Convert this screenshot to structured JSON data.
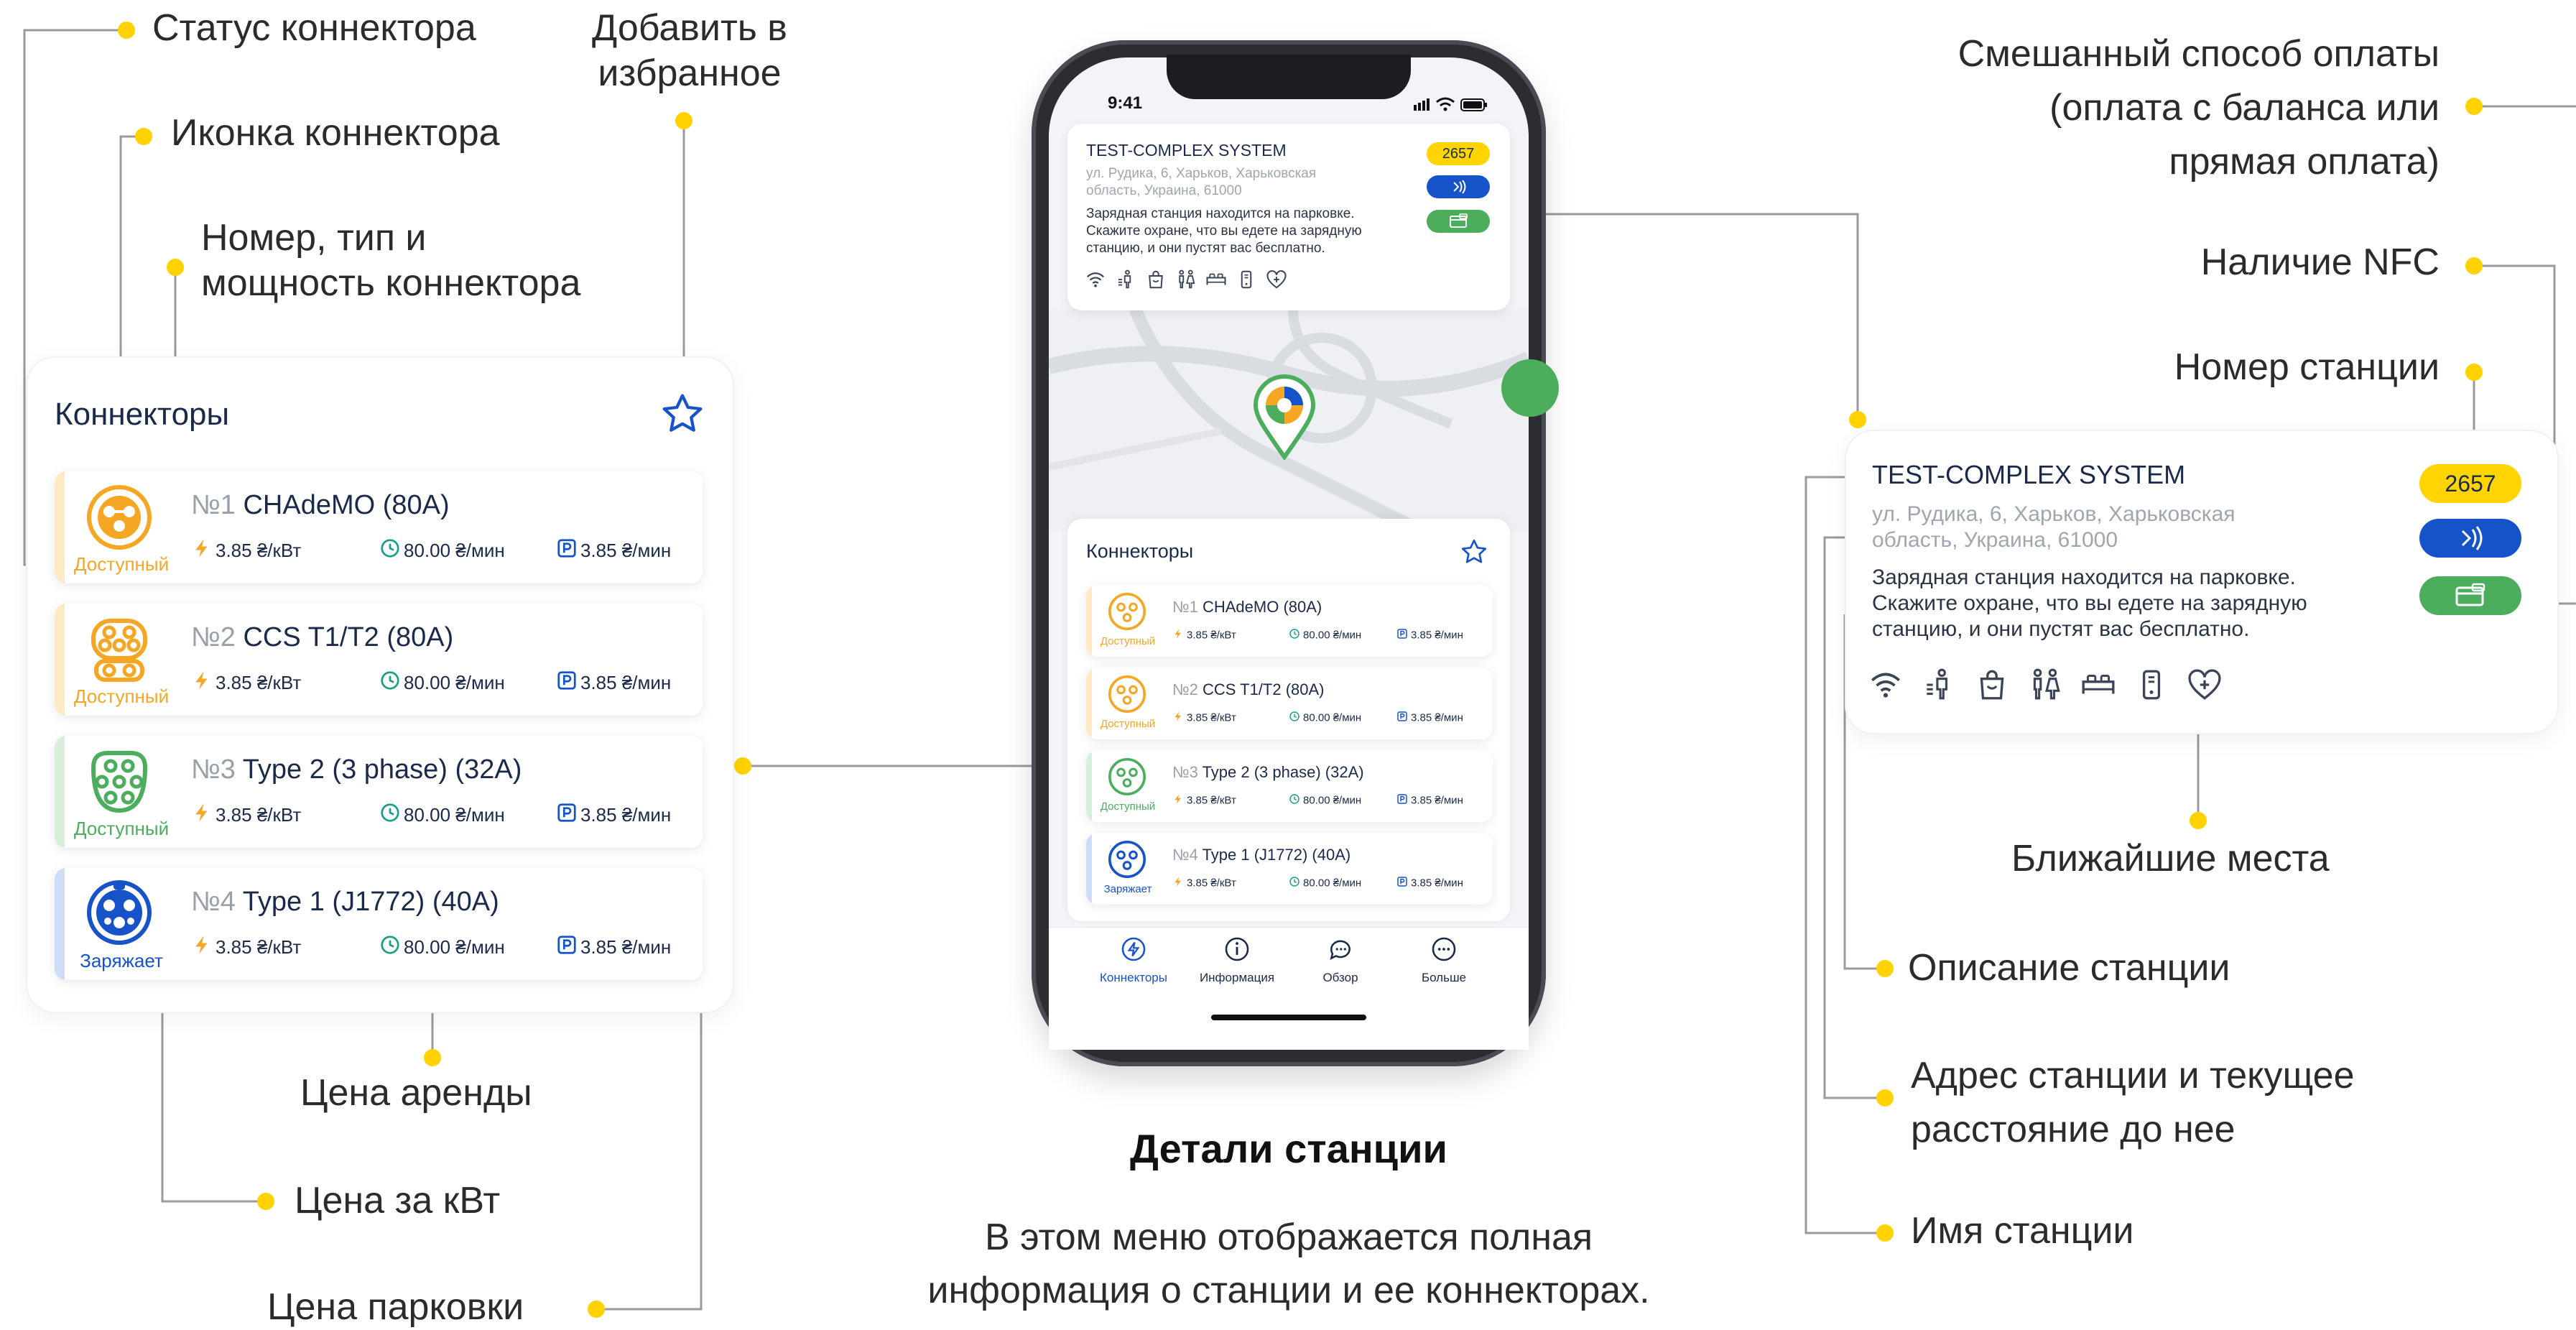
{
  "callouts": {
    "connector_status": "Статус коннектора",
    "add_favorite": "Добавить в\nизбранное",
    "connector_icon": "Иконка коннектора",
    "connector_number_type_power": "Номер, тип и\nмощность коннектора",
    "rental_price": "Цена аренды",
    "price_per_kw": "Цена за кВт",
    "parking_price": "Цена парковки",
    "mixed_payment": "Смешанный способ оплаты\n(оплата с баланса или\nпрямая оплата)",
    "nfc": "Наличие NFC",
    "station_number": "Номер станции",
    "nearby_places": "Ближайшие места",
    "station_description": "Описание станции",
    "station_address_distance": "Адрес станции и текущее\nрасстояние до нее",
    "station_name": "Имя станции"
  },
  "caption": {
    "title": "Детали станции",
    "text": "В этом меню отображается полная\nинформация о станции и ее коннекторах."
  },
  "station": {
    "name": "TEST-COMPLEX SYSTEM",
    "address": "ул. Рудика, 6, Харьков, Харьковская\nобласть, Украина, 61000",
    "description": "Зарядная станция находится на парковке.\nСкажите охране, что вы едете на зарядную\nстанцию, и они пустят вас бесплатно.",
    "number": "2657",
    "nfc_icon": "nfc-icon",
    "payment_icon": "wallet-card-icon",
    "amenities": [
      "wifi-icon",
      "restroom-icon",
      "shop-icon",
      "toilets-icon",
      "hotel-icon",
      "phone-icon",
      "hospital-icon"
    ]
  },
  "connectors_panel": {
    "title": "Коннекторы",
    "favorite_icon": "star-outline-icon"
  },
  "connectors": [
    {
      "num": "№1",
      "name": "CHAdeMO (80A)",
      "status": "Доступный",
      "status_color": "#f5a623",
      "price_kw": "3.85 ₴/кВт",
      "price_time": "80.00 ₴/мин",
      "price_parking": "3.85 ₴/мин"
    },
    {
      "num": "№2",
      "name": "CCS T1/T2 (80A)",
      "status": "Доступный",
      "status_color": "#f5a623",
      "price_kw": "3.85 ₴/кВт",
      "price_time": "80.00 ₴/мин",
      "price_parking": "3.85 ₴/мин"
    },
    {
      "num": "№3",
      "name": "Type 2 (3 phase) (32A)",
      "status": "Доступный",
      "status_color": "#4cae5c",
      "price_kw": "3.85 ₴/кВт",
      "price_time": "80.00 ₴/мин",
      "price_parking": "3.85 ₴/мин"
    },
    {
      "num": "№4",
      "name": "Type 1 (J1772) (40A)",
      "status": "Заряжает",
      "status_color": "#1653c8",
      "price_kw": "3.85 ₴/кВт",
      "price_time": "80.00 ₴/мин",
      "price_parking": "3.85 ₴/мин"
    }
  ],
  "phone": {
    "time": "9:41",
    "tabs": [
      {
        "label": "Коннекторы",
        "icon": "bolt-circle-icon"
      },
      {
        "label": "Информация",
        "icon": "info-circle-icon"
      },
      {
        "label": "Обзор",
        "icon": "comment-icon"
      },
      {
        "label": "Больше",
        "icon": "more-dots-icon"
      }
    ]
  },
  "colors": {
    "yellow": "#ffd200",
    "navy": "#1b2a4a",
    "blue": "#1653c8",
    "green": "#4cae5c",
    "orange": "#f5a623"
  }
}
